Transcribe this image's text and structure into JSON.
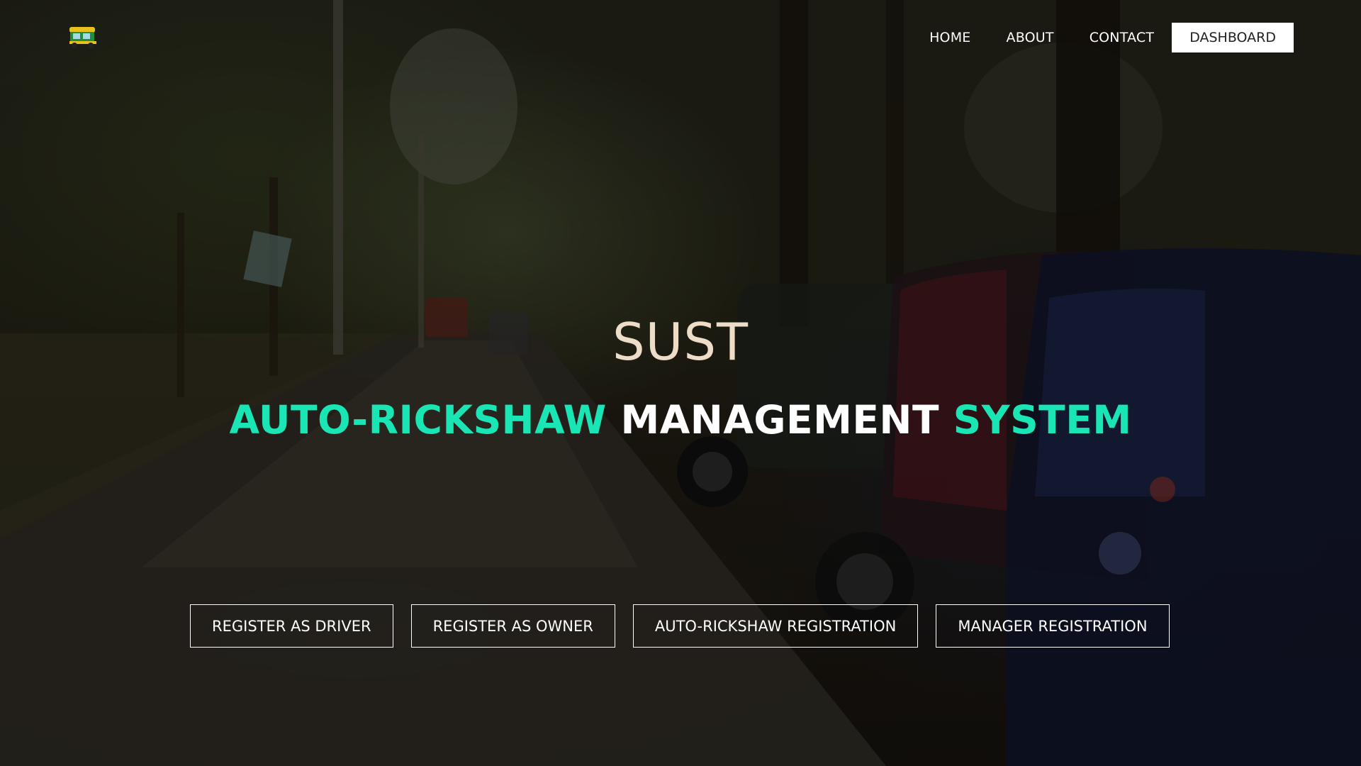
{
  "nav": {
    "logo_icon": "auto-rickshaw-icon",
    "links": [
      {
        "label": "HOME"
      },
      {
        "label": "ABOUT"
      },
      {
        "label": "CONTACT"
      }
    ],
    "dashboard_label": "DASHBOARD"
  },
  "hero": {
    "title": "SUST",
    "subtitle_part1": "AUTO-RICKSHAW",
    "subtitle_part2": "MANAGEMENT",
    "subtitle_part3": "SYSTEM"
  },
  "actions": [
    {
      "label": "REGISTER AS DRIVER"
    },
    {
      "label": "REGISTER AS OWNER"
    },
    {
      "label": "AUTO-RICKSHAW REGISTRATION"
    },
    {
      "label": "MANAGER REGISTRATION"
    }
  ],
  "colors": {
    "accent": "#19e6b4",
    "title": "#ecdcc8",
    "text": "#ffffff",
    "dashboard_bg": "#ffffff"
  }
}
